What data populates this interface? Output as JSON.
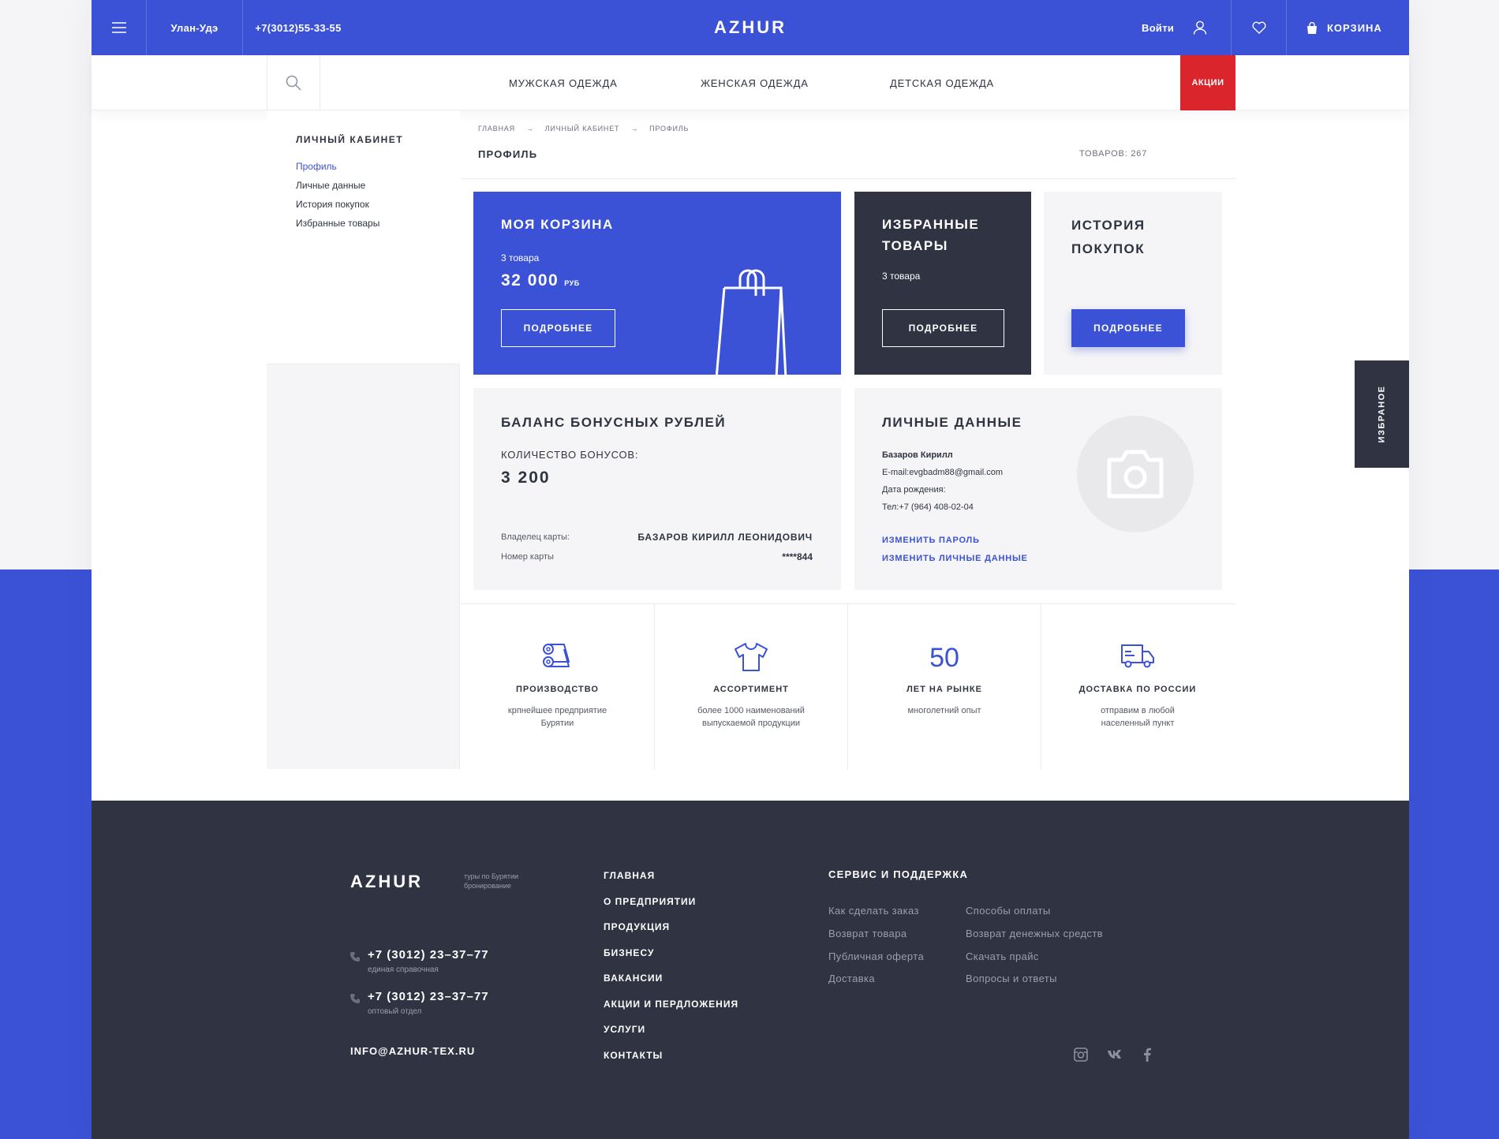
{
  "colors": {
    "accent": "#3b52d6",
    "dark": "#2f3342",
    "sale": "#d9252b",
    "light": "#f5f5f7"
  },
  "header": {
    "menu_icon": "hamburger-icon",
    "city": "Улан-Удэ",
    "phone": "+7(3012)55-33-55",
    "logo": "AZHUR",
    "login": "Войти",
    "cart": "КОРЗИНА"
  },
  "nav": {
    "items": [
      "МУЖСКАЯ ОДЕЖДА",
      "ЖЕНСКАЯ ОДЕЖДА",
      "ДЕТСКАЯ ОДЕЖДА"
    ],
    "sale": "АКЦИИ"
  },
  "sidebar": {
    "title": "ЛИЧНЫЙ КАБИНЕТ",
    "items": [
      "Профиль",
      "Личные данные",
      "История покупок",
      "Избранные товары"
    ]
  },
  "breadcrumbs": [
    "ГЛАВНАЯ",
    "→",
    "ЛИЧНЫЙ КАБИНЕТ",
    "→",
    "ПРОФИЛЬ"
  ],
  "page": {
    "title": "ПРОФИЛЬ",
    "count": "ТОВАРОВ: 267"
  },
  "cart_card": {
    "title": "МОЯ КОРЗИНА",
    "items": "3 товара",
    "amount": "32 000",
    "currency": "РУБ",
    "button": "ПОДРОБНЕЕ"
  },
  "fav_card": {
    "title1": "ИЗБРАННЫЕ",
    "title2": "ТОВАРЫ",
    "items": "3 товара",
    "button": "ПОДРОБНЕЕ"
  },
  "history_card": {
    "title1": "ИСТОРИЯ",
    "title2": "ПОКУПОК",
    "button": "ПОДРОБНЕЕ"
  },
  "bonus_card": {
    "title": "БАЛАНС БОНУСНЫХ РУБЛЕЙ",
    "label": "КОЛИЧЕСТВО БОНУСОВ:",
    "value": "3 200",
    "owner_label": "Владелец карты:",
    "owner": "БАЗАРОВ КИРИЛЛ ЛЕОНИДОВИЧ",
    "number_label": "Номер карты",
    "number": "****844"
  },
  "personal_card": {
    "title": "ЛИЧНЫЕ ДАННЫЕ",
    "name": "Базаров Кирилл",
    "email": "E-mail:evgbadm88@gmail.com",
    "birth": "Дата рождения:",
    "phone": "Тел:+7 (964) 408-02-04",
    "link1": "ИЗМЕНИТЬ ПАРОЛЬ",
    "link2": "ИЗМЕНИТЬ ЛИЧНЫЕ ДАННЫЕ"
  },
  "features": [
    {
      "icon": "fabric-rolls-icon",
      "title": "ПРОИЗВОДСТВО",
      "line1": "крпнейшее предприятие",
      "line2": "Бурятии"
    },
    {
      "icon": "tshirt-icon",
      "title": "АССОРТИМЕНТ",
      "line1": "более 1000 наименований",
      "line2": "выпускаемой продукции"
    },
    {
      "icon": "number-50",
      "number": "50",
      "title": "ЛЕТ НА РЫНКЕ",
      "line1": "многолетний опыт",
      "line2": ""
    },
    {
      "icon": "truck-icon",
      "title": "ДОСТАВКА ПО РОССИИ",
      "line1": "отправим в любой",
      "line2": "населенный пункт"
    }
  ],
  "fav_tab": "ИЗБРАНОЕ",
  "footer": {
    "logo": "AZHUR",
    "tagline1": "туры по Бурятии",
    "tagline2": "бронирование",
    "phone1": "+7 (3012) 23–37–77",
    "phone1_sub": "единая справочная",
    "phone2": "+7 (3012) 23–37–77",
    "phone2_sub": "оптовый отдел",
    "email": "INFO@AZHUR-TEX.RU",
    "menu": [
      "ГЛАВНАЯ",
      "О ПРЕДПРИЯТИИ",
      "ПРОДУКЦИЯ",
      "БИЗНЕСУ",
      "ВАКАНСИИ",
      "АКЦИИ И ПЕРДЛОЖЕНИЯ",
      "УСЛУГИ",
      "КОНТАКТЫ"
    ],
    "service_title": "СЕРВИС И ПОДДЕРЖКА",
    "service_col1": [
      "Как сделать заказ",
      "Возврат товара",
      "Публичная оферта",
      "Доставка"
    ],
    "service_col2": [
      "Способы оплаты",
      "Возврат денежных средств",
      "Скачать прайс",
      "Вопросы и ответы"
    ],
    "social": [
      "instagram-icon",
      "vk-icon",
      "facebook-icon"
    ]
  }
}
